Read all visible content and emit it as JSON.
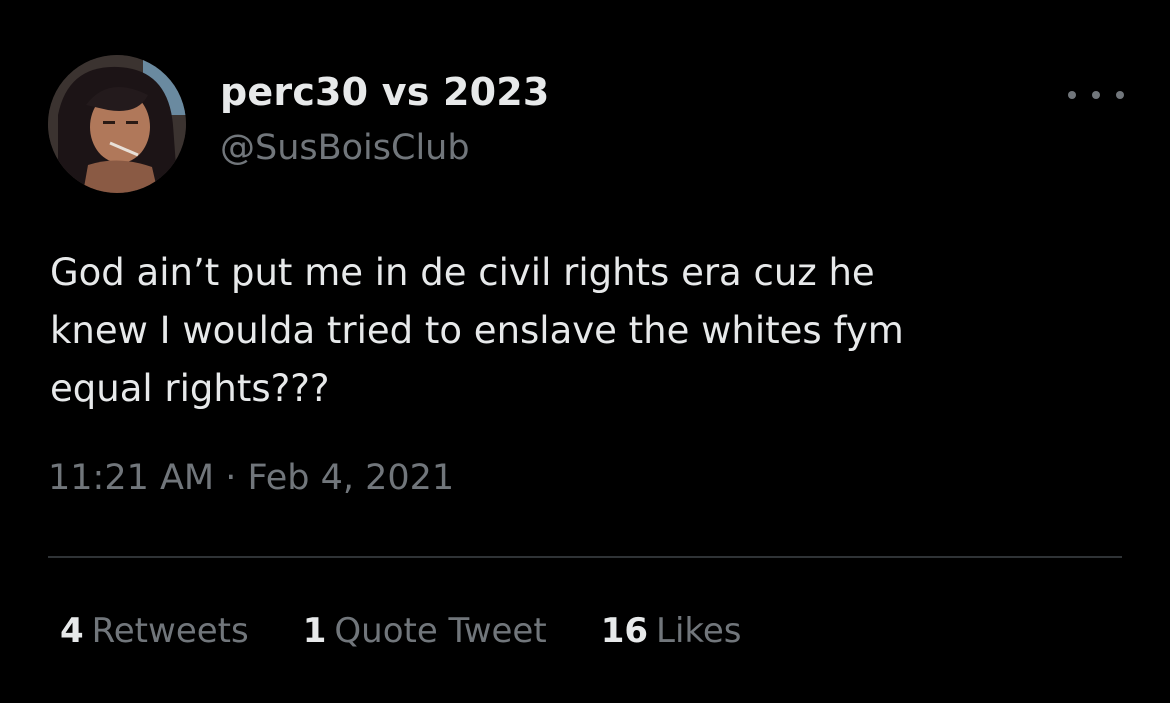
{
  "tweet": {
    "author": {
      "display_name": "perc30 vs 2023",
      "handle": "@SusBoisClub",
      "avatar": "avatar-image"
    },
    "more_icon": "more-horizontal-icon",
    "text_lines": [
      "God ain’t put me in de civil rights era cuz he",
      "knew I woulda tried to enslave the whites fym",
      "equal rights???"
    ],
    "timestamp": "11:21 AM · Feb 4, 2021",
    "stats": {
      "retweets": {
        "count": "4",
        "label": "Retweets"
      },
      "quote_tweets": {
        "count": "1",
        "label": "Quote Tweet"
      },
      "likes": {
        "count": "16",
        "label": "Likes"
      }
    }
  },
  "colors": {
    "background": "#000000",
    "primary_text": "#e7e9ea",
    "secondary_text": "#71767b",
    "divider": "#2f3336"
  }
}
